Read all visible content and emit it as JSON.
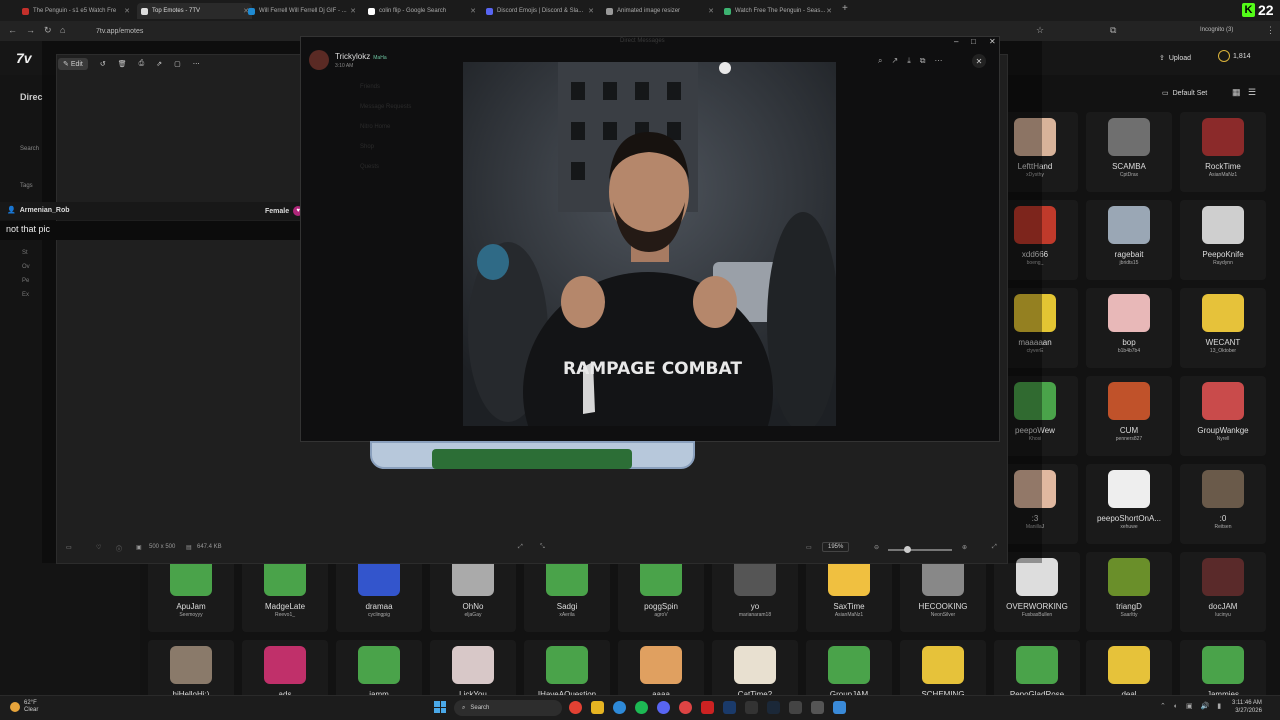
{
  "browser": {
    "tabs": [
      {
        "label": "The Penguin - s1 e5 Watch Fre",
        "color": "#c4302b"
      },
      {
        "label": "Top Emotes - 7TV",
        "color": "#dddddd",
        "active": true
      },
      {
        "label": "Will Ferrell Will Ferrell Dj GIF - ...",
        "color": "#1f8ad1"
      },
      {
        "label": "colin flip - Google Search",
        "color": "#ffffff"
      },
      {
        "label": "Discord Emojis | Discord & Sla...",
        "color": "#5865f2"
      },
      {
        "label": "Animated image resizer",
        "color": "#999999"
      },
      {
        "label": "Watch Free The Penguin - Seas...",
        "color": "#3cb371"
      }
    ],
    "new_tab": "+",
    "url": "7tv.app/emotes",
    "incognito": "Incognito (3)",
    "kick_count": "22"
  },
  "site": {
    "logo": "7v",
    "upload": "Upload",
    "balance": "1,814",
    "default_set": "Default Set",
    "directory": "Direc",
    "search_label": "Search",
    "tags_label": "Tags",
    "left_options": [
      "St",
      "Ov",
      "Pe",
      "Ex"
    ]
  },
  "viewer": {
    "edit": "Edit",
    "dimensions": "500 x 500",
    "filesize": "647.4 KB",
    "zoom": "195%"
  },
  "user_strip": {
    "name": "Armenian_Rob",
    "gender": "Female",
    "caption": "not that pic"
  },
  "discord": {
    "title": "Direct Messages",
    "poster": "Trickylokz",
    "badge": "MaHa",
    "time": "3:10 AM",
    "photo_shirt": "RAMPAGE COMBAT",
    "sidebar_faint": [
      "Friends",
      "Message Requests",
      "Nitro Home",
      "Shop",
      "Quests"
    ]
  },
  "emotes": [
    {
      "name": "LefttHand",
      "author": "xDysthy",
      "color": "#d8b39a"
    },
    {
      "name": "SCAMBA",
      "author": "CptDrax",
      "color": "#6f6f6f"
    },
    {
      "name": "RockTime",
      "author": "AsianMaNz1",
      "color": "#8b2a2a"
    },
    {
      "name": "xdd666",
      "author": "boeng_",
      "color": "#c03a2b"
    },
    {
      "name": "ragebait",
      "author": "jbridts15",
      "color": "#9aa7b5"
    },
    {
      "name": "PeepoKnife",
      "author": "Raydynn",
      "color": "#cfcfcf"
    },
    {
      "name": "maaaaan",
      "author": "ctyverE",
      "color": "#e3c533"
    },
    {
      "name": "bop",
      "author": "b1b4b7b4",
      "color": "#e8b8b8"
    },
    {
      "name": "WECANT",
      "author": "13_Oktober",
      "color": "#e6c23a"
    },
    {
      "name": "peepoWew",
      "author": "Khosi",
      "color": "#4aa34a"
    },
    {
      "name": "CUM",
      "author": "penners827",
      "color": "#c0522a"
    },
    {
      "name": "GroupWankge",
      "author": "Nyrell",
      "color": "#c94b4b"
    },
    {
      "name": ":3",
      "author": "ManillaJ",
      "color": "#e0b8a0"
    },
    {
      "name": "peepoShortOnA...",
      "author": "xehuwe",
      "color": "#eeeeee"
    },
    {
      "name": ":0",
      "author": "Reitsen",
      "color": "#6a5a4a"
    },
    {
      "name": "ApuJam",
      "author": "Seemoyyy",
      "color": "#4aa34a"
    },
    {
      "name": "MadgeLate",
      "author": "Reevo1_",
      "color": "#4aa34a"
    },
    {
      "name": "dramaa",
      "author": "cyclingpig",
      "color": "#3355cc"
    },
    {
      "name": "OhNo",
      "author": "eljaGay",
      "color": "#aaaaaa"
    },
    {
      "name": "Sadgi",
      "author": "xAerila",
      "color": "#4aa34a"
    },
    {
      "name": "poggSpin",
      "author": "agroV",
      "color": "#4aa34a"
    },
    {
      "name": "yo",
      "author": "marianaram18",
      "color": "#555555"
    },
    {
      "name": "SaxTime",
      "author": "AsianMaNz1",
      "color": "#f0c040"
    },
    {
      "name": "HECOOKING",
      "author": "NeonSilver",
      "color": "#888888"
    },
    {
      "name": "OVERWORKING",
      "author": "FusbasBullen",
      "color": "#dddddd"
    },
    {
      "name": "triangD",
      "author": "Saarltty",
      "color": "#6a8f2a"
    },
    {
      "name": "docJAM",
      "author": "lucinyu",
      "color": "#5a2a2a"
    },
    {
      "name": "hiHelloHi:)",
      "author": "Lopa77",
      "color": "#8a7a6a"
    },
    {
      "name": "ads",
      "author": "RubenVatle",
      "color": "#c0306a"
    },
    {
      "name": "jamm",
      "author": "crazycarrot998",
      "color": "#4aa34a"
    },
    {
      "name": "LickYou",
      "author": "Envttt",
      "color": "#d8c8c8"
    },
    {
      "name": "IHaveAQuestion",
      "author": "afoxeXY",
      "color": "#4aa34a"
    },
    {
      "name": "aaaa",
      "author": "Bortuus",
      "color": "#e0a060"
    },
    {
      "name": "CatTime2",
      "author": "TamzidFarhanMogno",
      "color": "#e8e0d0"
    },
    {
      "name": "GroupJAM",
      "author": "Rul_i",
      "color": "#4aa34a"
    },
    {
      "name": "SCHEMING",
      "author": "cynocrysys",
      "color": "#e6c23a"
    },
    {
      "name": "PepoGladRose",
      "author": "xSlapShot_",
      "color": "#4aa34a"
    },
    {
      "name": "deal",
      "author": "ophyra",
      "color": "#e6c23a"
    },
    {
      "name": "Jammies",
      "author": "kathi",
      "color": "#4aa34a"
    }
  ],
  "taskbar": {
    "temp": "62°F",
    "weather": "Clear",
    "search": "Search",
    "time": "3:11:46 AM",
    "date": "3/27/2026"
  }
}
